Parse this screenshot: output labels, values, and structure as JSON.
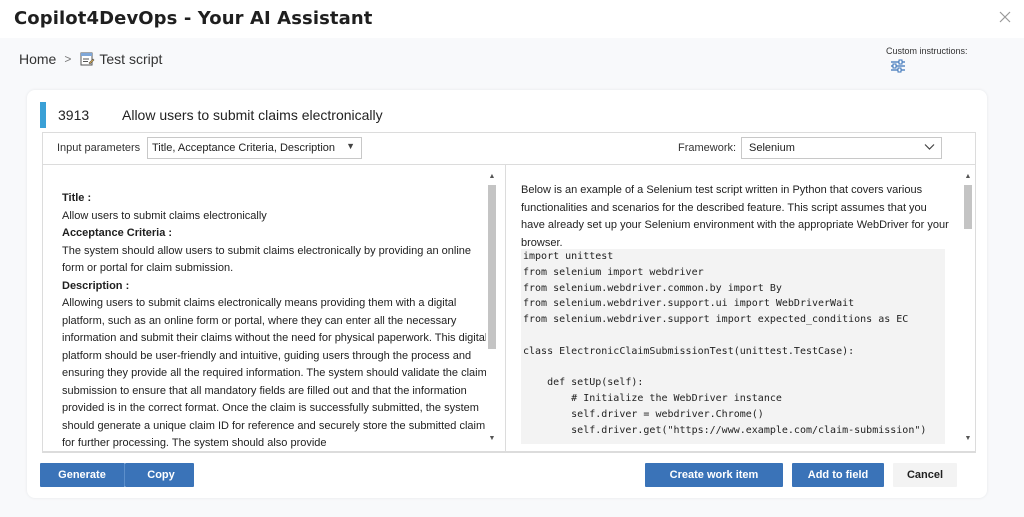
{
  "app": {
    "title": "Copilot4DevOps - Your AI Assistant"
  },
  "breadcrumb": {
    "home": "Home",
    "separator": ">",
    "current": "Test script",
    "current_icon": "test-script-icon"
  },
  "custom_instructions": {
    "label": "Custom instructions:",
    "icon": "sliders-icon"
  },
  "work_item": {
    "id": "3913",
    "title": "Allow users to submit claims electronically",
    "accent_color": "#3aa0d6"
  },
  "params": {
    "input_label": "Input parameters",
    "input_value": "Title, Acceptance Criteria, Description",
    "framework_label": "Framework:",
    "framework_value": "Selenium"
  },
  "left_pane": {
    "title_label": "Title :",
    "title_value": "Allow users to submit claims electronically",
    "ac_label": "Acceptance Criteria :",
    "ac_value": "The system should allow users to submit claims electronically by providing an online form or portal for claim submission.",
    "desc_label": "Description :",
    "desc_value": "Allowing users to submit claims electronically means providing them with a digital platform, such as an online form or portal, where they can enter all the necessary information and submit their claims without the need for physical paperwork. This digital platform should be user-friendly and intuitive, guiding users through the process and ensuring they provide all the required information. The system should validate the claim submission to ensure that all mandatory fields are filled out and that the information provided is in the correct format. Once the claim is successfully submitted, the system should generate a unique claim ID for reference and securely store the submitted claim for further processing. The system should also provide"
  },
  "right_pane": {
    "intro": "Below is an example of a Selenium test script written in Python that covers various functionalities and scenarios for the described feature. This script assumes that you have already set up your Selenium environment with the appropriate WebDriver for your browser.",
    "code": "import unittest\nfrom selenium import webdriver\nfrom selenium.webdriver.common.by import By\nfrom selenium.webdriver.support.ui import WebDriverWait\nfrom selenium.webdriver.support import expected_conditions as EC\n\nclass ElectronicClaimSubmissionTest(unittest.TestCase):\n\n    def setUp(self):\n        # Initialize the WebDriver instance\n        self.driver = webdriver.Chrome()\n        self.driver.get(\"https://www.example.com/claim-submission\")"
  },
  "buttons": {
    "generate": "Generate",
    "copy": "Copy",
    "create_work_item": "Create work item",
    "add_to_field": "Add to field",
    "cancel": "Cancel"
  },
  "colors": {
    "primary_button": "#3a73b8",
    "cancel_button": "#f3f3f3"
  }
}
